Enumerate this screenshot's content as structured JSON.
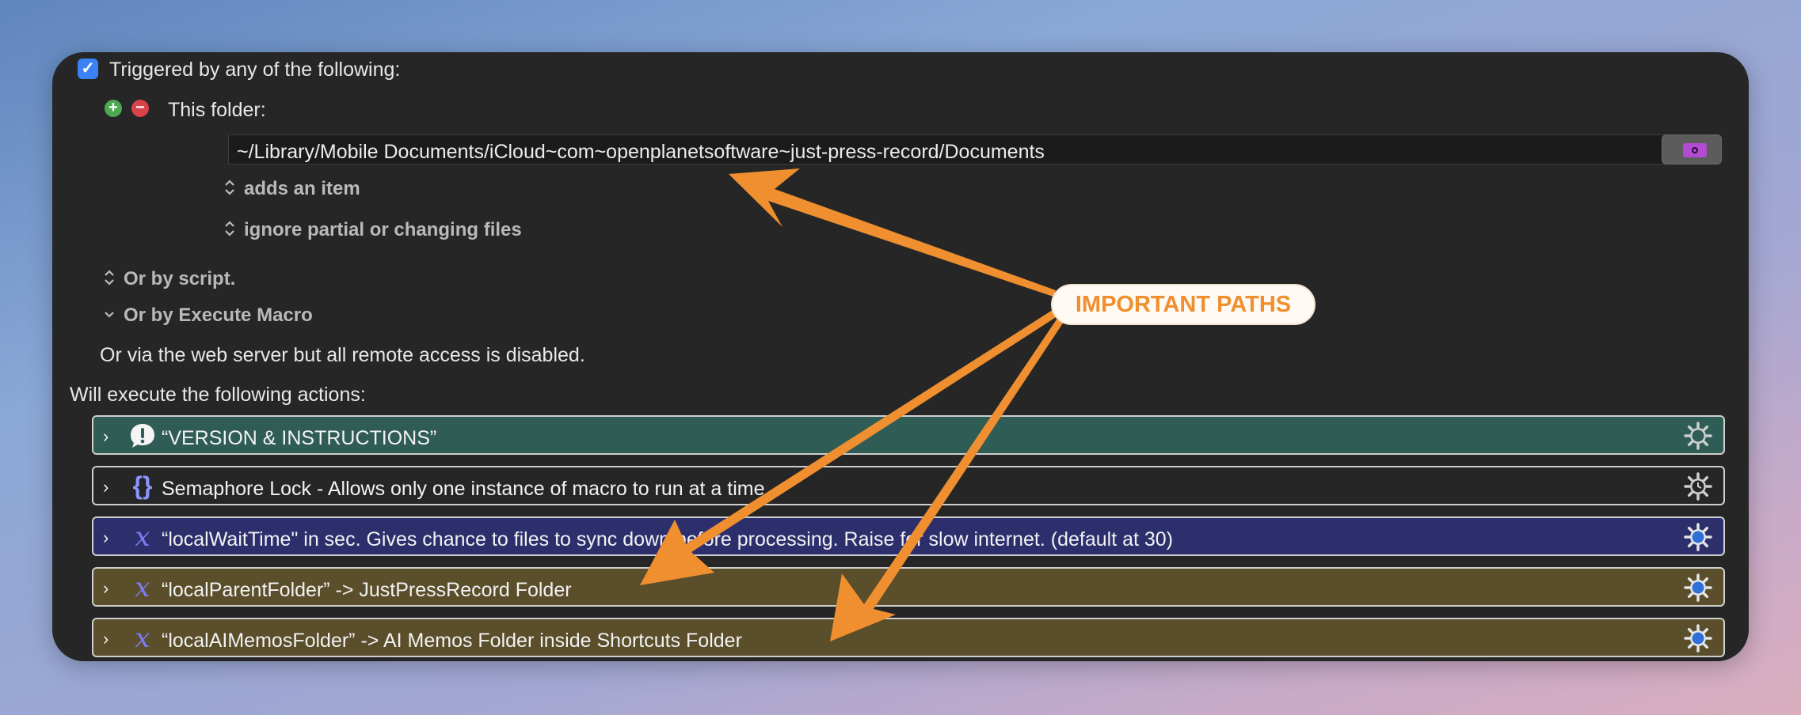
{
  "trigger": {
    "checkbox_checked": true,
    "label": "Triggered by any of the following:",
    "folder_label": "This folder:",
    "folder_path": "~/Library/Mobile Documents/iCloud~com~openplanetsoftware~just-press-record/Documents",
    "event_option": "adds an item",
    "partial_option": "ignore partial or changing files",
    "or_script": "Or by script.",
    "or_execute_macro": "Or by Execute Macro",
    "web_server_note": "Or via the web server but all remote access is disabled."
  },
  "actions": {
    "heading": "Will execute the following actions:",
    "rows": [
      {
        "label": "“VERSION & INSTRUCTIONS”",
        "icon": "exclamation-bubble-icon",
        "color": "#2f5d56"
      },
      {
        "label": "Semaphore Lock - Allows only one instance of macro to run at a time.",
        "icon": "braces-icon",
        "color": "#262626"
      },
      {
        "label": "“localWaitTime\" in sec. Gives chance to files to sync down before processing. Raise for slow internet. (default at 30)",
        "icon": "variable-x-icon",
        "color": "#2d2f6c"
      },
      {
        "label": "“localParentFolder” -> JustPressRecord Folder",
        "icon": "variable-x-icon",
        "color": "#5a4e2b"
      },
      {
        "label": "“localAIMemosFolder” -> AI Memos Folder inside Shortcuts Folder",
        "icon": "variable-x-icon",
        "color": "#5a4e2b"
      }
    ]
  },
  "annotation": {
    "label": "IMPORTANT PATHS",
    "color": "#ef8f2d"
  },
  "icons": {
    "plus": "+",
    "minus": "−",
    "check": "✓",
    "updown": "⌃⌄",
    "row_chevron": "›",
    "x": "𝑥"
  }
}
